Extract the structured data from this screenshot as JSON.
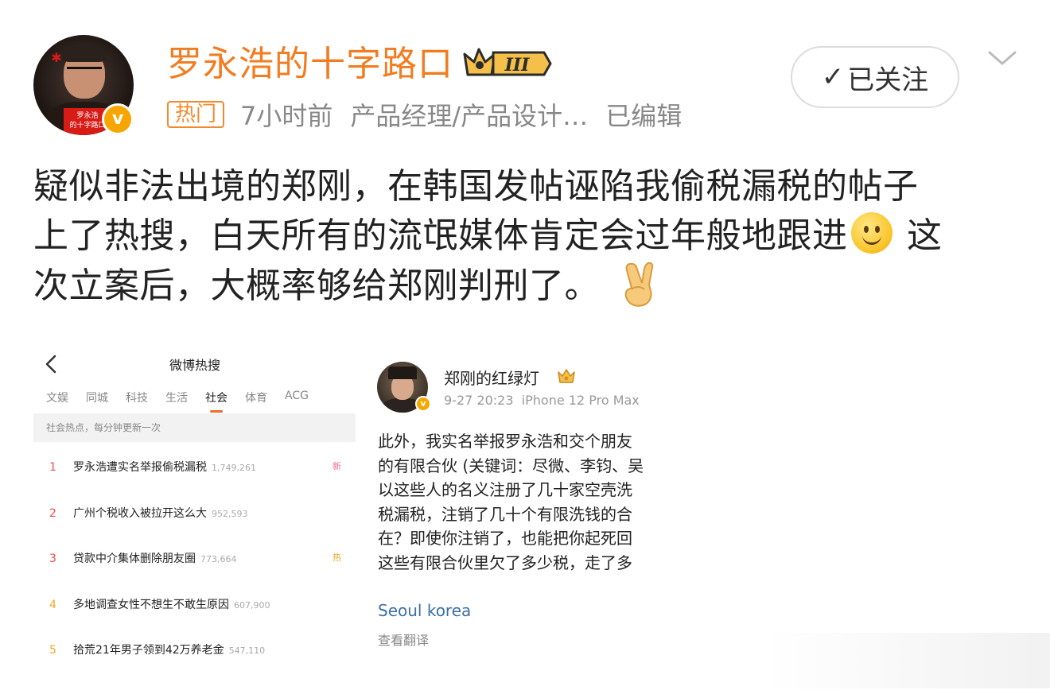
{
  "header": {
    "username": "罗永浩的十字路口",
    "level_badge": "III",
    "avatar_band_text": "罗永浩\n的十字路口",
    "verified_badge": "v",
    "hot_tag": "热门",
    "time": "7小时前",
    "category": "产品经理/产品设计…",
    "edited": "已编辑",
    "follow_label": "已关注",
    "follow_check": "✓"
  },
  "post": {
    "lines": [
      "疑似非法出境的郑刚，在韩国发帖诬陷我偷税漏税的帖子",
      "上了热搜，白天所有的流氓媒体肯定会过年般地跟进",
      " 这",
      "次立案后，大概率够给郑刚判刑了。"
    ]
  },
  "hotsearch": {
    "title": "微博热搜",
    "tabs": [
      "文娱",
      "同城",
      "科技",
      "生活",
      "社会",
      "体育",
      "ACG"
    ],
    "active_tab": "社会",
    "notice": "社会热点，每分钟更新一次",
    "items": [
      {
        "rank": "1",
        "text": "罗永浩遭实名举报偷税漏税",
        "count": "1,749,261",
        "badge": "新",
        "badge_color": "#f26b8a",
        "rank_color": "#f04a4a"
      },
      {
        "rank": "2",
        "text": "广州个税收入被拉开这么大",
        "count": "952,593",
        "badge": "",
        "badge_color": "",
        "rank_color": "#f04a4a"
      },
      {
        "rank": "3",
        "text": "贷款中介集体删除朋友圈",
        "count": "773,664",
        "badge": "热",
        "badge_color": "#f5a623",
        "rank_color": "#f04a4a"
      },
      {
        "rank": "4",
        "text": "多地调查女性不想生不敢生原因",
        "count": "607,900",
        "badge": "",
        "badge_color": "",
        "rank_color": "#f5a623"
      },
      {
        "rank": "5",
        "text": "拾荒21年男子领到42万养老金",
        "count": "547,110",
        "badge": "",
        "badge_color": "",
        "rank_color": "#f5a623"
      }
    ]
  },
  "zhenggang": {
    "name": "郑刚的红绿灯",
    "verified_badge": "v",
    "meta": "9-27 20:23  iPhone 12 Pro Max",
    "lines": [
      "此外，我实名举报罗永浩和交个朋友",
      "的有限合伙 (关键词：尽微、李钧、吴",
      "以这些人的名义注册了几十家空壳洗",
      "税漏税，注销了几十个有限洗钱的合",
      "在？即使你注销了，也能把你起死回",
      "这些有限合伙里欠了多少税，走了多"
    ],
    "location": "Seoul korea",
    "translate": "查看翻译"
  },
  "colors": {
    "username": "#f27c1f",
    "hot_tag": "#f28a2c",
    "active_tab_underline": "#f26b2b",
    "link": "#3a6fa8",
    "verified": "#f7a600"
  }
}
